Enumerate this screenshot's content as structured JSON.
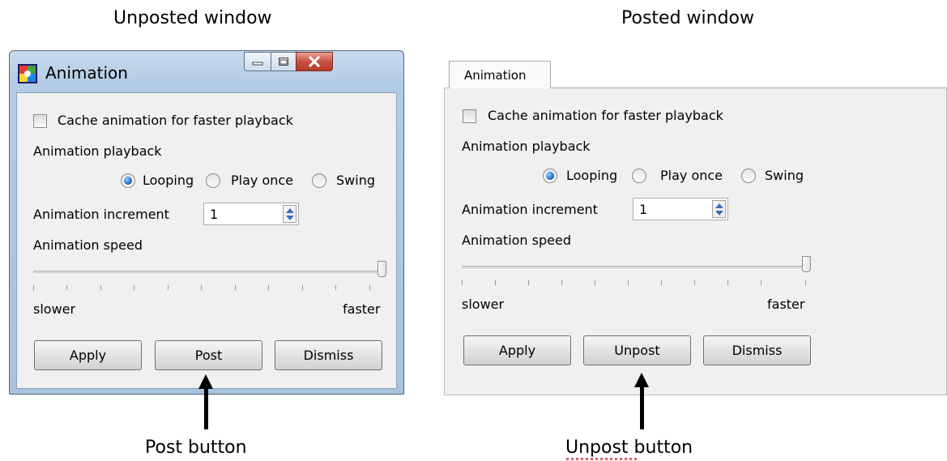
{
  "captions": {
    "left_title": "Unposted window",
    "right_title": "Posted window",
    "post_button_label": "Post button",
    "unpost_button_label": "Unpost button"
  },
  "unposted": {
    "window_title": "Animation",
    "cache_checkbox": {
      "label": "Cache animation for faster playback",
      "checked": false
    },
    "playback_label": "Animation playback",
    "playback_options": [
      {
        "label": "Looping",
        "selected": true
      },
      {
        "label": "Play once",
        "selected": false
      },
      {
        "label": "Swing",
        "selected": false
      }
    ],
    "increment_label": "Animation increment",
    "increment_value": "1",
    "speed_label": "Animation speed",
    "speed_level": 1.0,
    "slower_label": "slower",
    "faster_label": "faster",
    "buttons": {
      "apply": "Apply",
      "post": "Post",
      "dismiss": "Dismiss"
    }
  },
  "posted": {
    "tab_label": "Animation",
    "cache_checkbox": {
      "label": "Cache animation for faster playback",
      "checked": false
    },
    "playback_label": "Animation playback",
    "playback_options": [
      {
        "label": "Looping",
        "selected": true
      },
      {
        "label": "Play once",
        "selected": false
      },
      {
        "label": "Swing",
        "selected": false
      }
    ],
    "increment_label": "Animation increment",
    "increment_value": "1",
    "speed_label": "Animation speed",
    "speed_level": 1.0,
    "slower_label": "slower",
    "faster_label": "faster",
    "buttons": {
      "apply": "Apply",
      "unpost": "Unpost",
      "dismiss": "Dismiss"
    }
  },
  "colors": {
    "window_frame": "#b3cbe4",
    "close_button": "#c75140",
    "radio_selected": "#1a5fb4",
    "dialog_background": "#f0f0f0"
  }
}
